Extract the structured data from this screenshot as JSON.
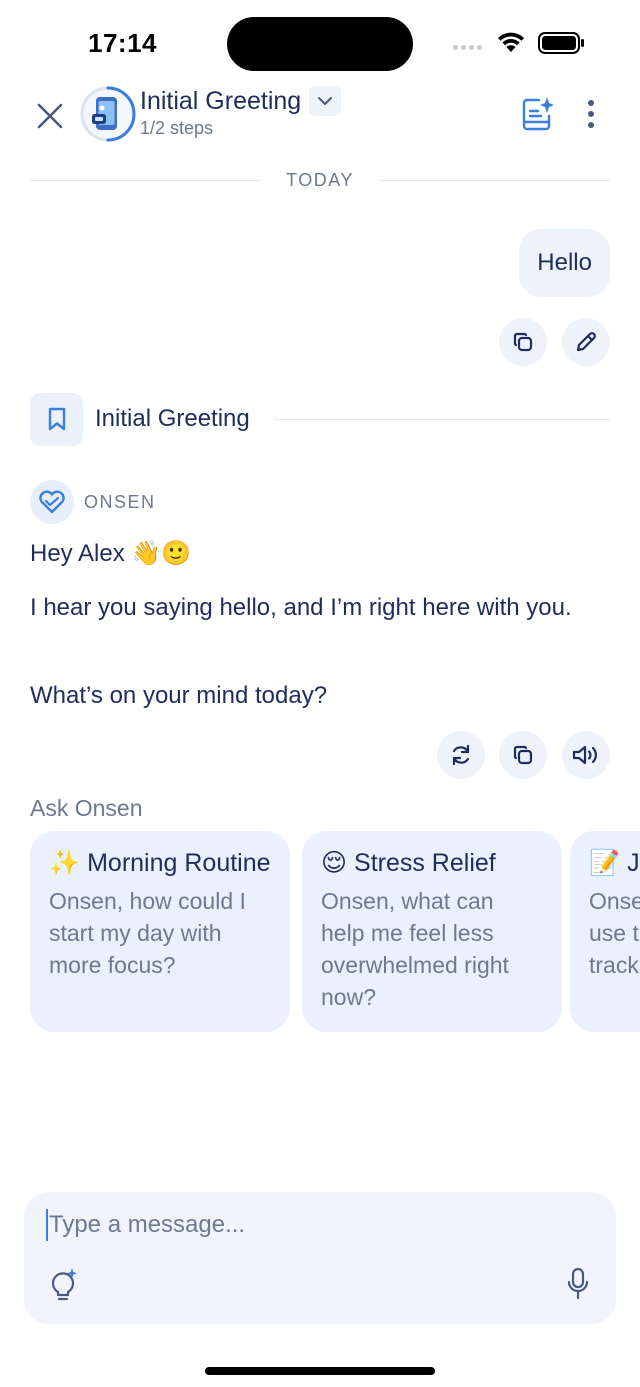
{
  "status_bar": {
    "time": "17:14"
  },
  "header": {
    "title": "Initial Greeting",
    "subtitle": "1/2 steps",
    "progress": 0.5
  },
  "date_divider": "TODAY",
  "user_message": "Hello",
  "step_marker": {
    "title": "Initial Greeting"
  },
  "assistant": {
    "name": "ONSEN",
    "messages": [
      "Hey Alex 👋🙂",
      "I hear you saying hello, and I’m right here with you.",
      "What’s on your mind today?"
    ]
  },
  "ask": {
    "label": "Ask Onsen",
    "cards": [
      {
        "emoji": "✨",
        "title": "Morning Routine",
        "body": "Onsen, how could I start my day with more focus?"
      },
      {
        "emoji": "😌",
        "title": "Stress Relief",
        "body": "Onsen, what can help me feel less overwhelmed right now?"
      },
      {
        "emoji": "📝",
        "title": "J",
        "body": "Onse use t track"
      }
    ]
  },
  "composer": {
    "placeholder": "Type a message..."
  },
  "colors": {
    "accent": "#3a7ee0",
    "text": "#1f2d5c",
    "muted": "#6d7891",
    "bubble": "#eef3fb"
  },
  "icons": [
    "close-icon",
    "chevron-down-icon",
    "notes-sparkle-icon",
    "more-vertical-icon",
    "copy-icon",
    "edit-icon",
    "bookmark-icon",
    "heart-logo-icon",
    "refresh-icon",
    "speaker-icon",
    "lightbulb-icon",
    "mic-icon"
  ]
}
